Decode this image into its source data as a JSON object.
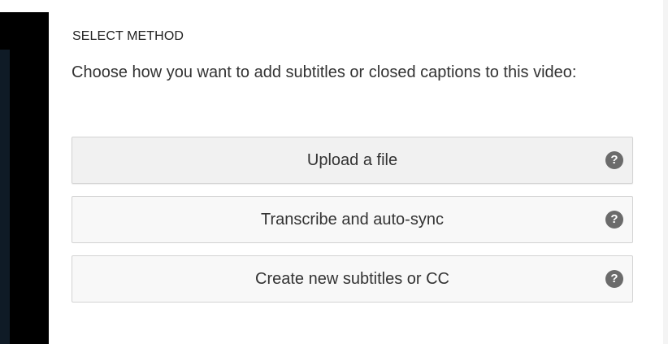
{
  "panel": {
    "heading": "SELECT METHOD",
    "description": "Choose how you want to add subtitles or closed captions to this video:"
  },
  "methods": [
    {
      "label": "Upload a file",
      "help_icon": "?"
    },
    {
      "label": "Transcribe and auto-sync",
      "help_icon": "?"
    },
    {
      "label": "Create new subtitles or CC",
      "help_icon": "?"
    }
  ],
  "icons": {
    "help": "question-circle-icon"
  },
  "colors": {
    "video_background": "#000000",
    "button_border": "#d3d3d3",
    "help_icon": "#6b6b6b",
    "text": "#333333"
  }
}
